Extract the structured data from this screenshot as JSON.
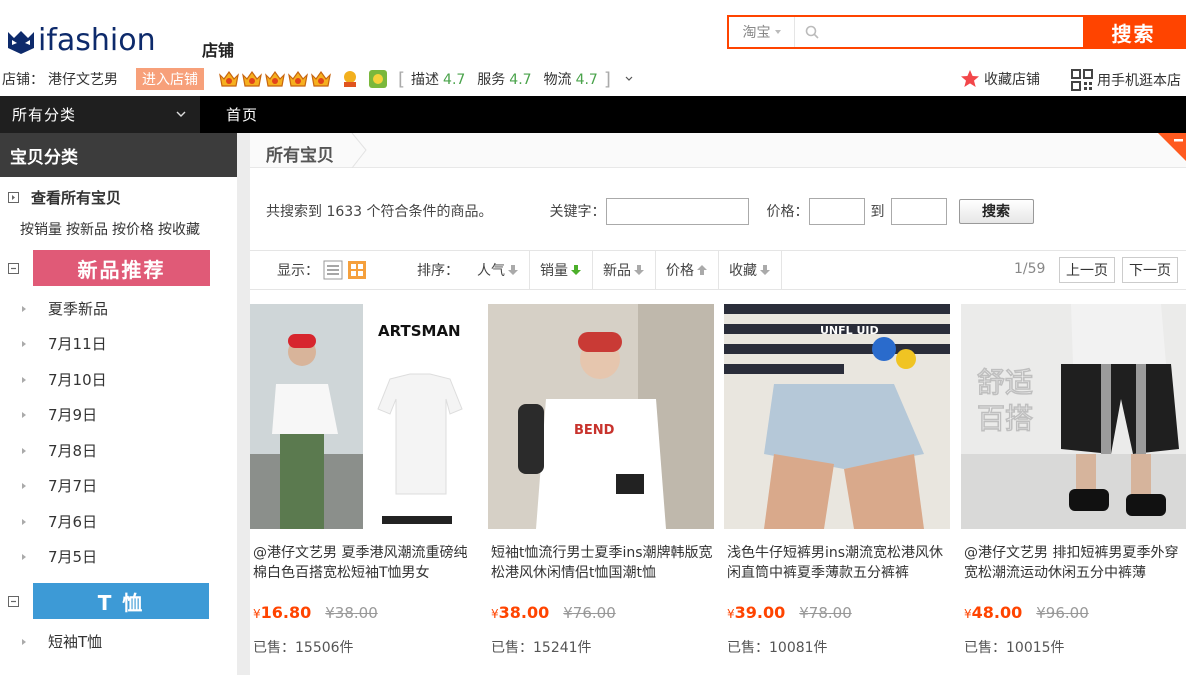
{
  "brand": {
    "logo_text": "ifashion",
    "shop_word": "店铺"
  },
  "search": {
    "scope": "淘宝",
    "placeholder": "",
    "button": "搜索"
  },
  "shop": {
    "label": "店铺：",
    "name": "港仔文艺男",
    "enter_button": "进入店铺",
    "crown_count": 5,
    "ratings": [
      {
        "label": "描述",
        "value": "4.7"
      },
      {
        "label": "服务",
        "value": "4.7"
      },
      {
        "label": "物流",
        "value": "4.7"
      }
    ],
    "favorite": "收藏店铺",
    "mobile": "用手机逛本店"
  },
  "nav": {
    "all_categories": "所有分类",
    "home": "首页"
  },
  "sidebar": {
    "title": "宝贝分类",
    "view_all": "查看所有宝贝",
    "sort_links": [
      "按销量",
      "按新品",
      "按价格",
      "按收藏"
    ],
    "categories": [
      {
        "banner": "新品推荐",
        "color": "#e05a77",
        "items": [
          "夏季新品",
          "7月11日",
          "7月10日",
          "7月9日",
          "7月8日",
          "7月7日",
          "7月6日",
          "7月5日"
        ]
      },
      {
        "banner": "T 恤",
        "color": "#3d9ad6",
        "items": [
          "短袖T恤"
        ]
      }
    ]
  },
  "main": {
    "title": "所有宝贝",
    "found_text": "共搜索到 1633 个符合条件的商品。",
    "keyword_label": "关键字：",
    "price_label": "价格：",
    "to_label": "到",
    "search_button": "搜索",
    "display_label": "显示：",
    "sort_label": "排序：",
    "sort_options": [
      "人气",
      "销量",
      "新品",
      "价格",
      "收藏"
    ],
    "page_count": "1/59",
    "prev_page": "上一页",
    "next_page": "下一页"
  },
  "products": [
    {
      "title": "@港仔文艺男 夏季港风潮流重磅纯棉白色百搭宽松短袖T恤男女",
      "price": "16.80",
      "original": "¥38.00",
      "sold": "已售：15506件",
      "image_text": "ARTSMAN"
    },
    {
      "title": "短袖t恤流行男士夏季ins潮牌韩版宽松港风休闲情侣t恤国潮t恤",
      "price": "38.00",
      "original": "¥76.00",
      "sold": "已售：15241件",
      "image_text": ""
    },
    {
      "title": "浅色牛仔短裤男ins潮流宽松港风休闲直筒中裤夏季薄款五分裤裤",
      "price": "39.00",
      "original": "¥78.00",
      "sold": "已售：10081件",
      "image_text": "UNFL UID"
    },
    {
      "title": "@港仔文艺男 排扣短裤男夏季外穿宽松潮流运动休闲五分中裤薄",
      "price": "48.00",
      "original": "¥96.00",
      "sold": "已售：10015件",
      "image_text": "舒适\n百搭"
    }
  ],
  "currency": "¥",
  "colors": {
    "accent": "#ff4400",
    "rating_green": "#4aa34b",
    "nav": "#000000"
  }
}
